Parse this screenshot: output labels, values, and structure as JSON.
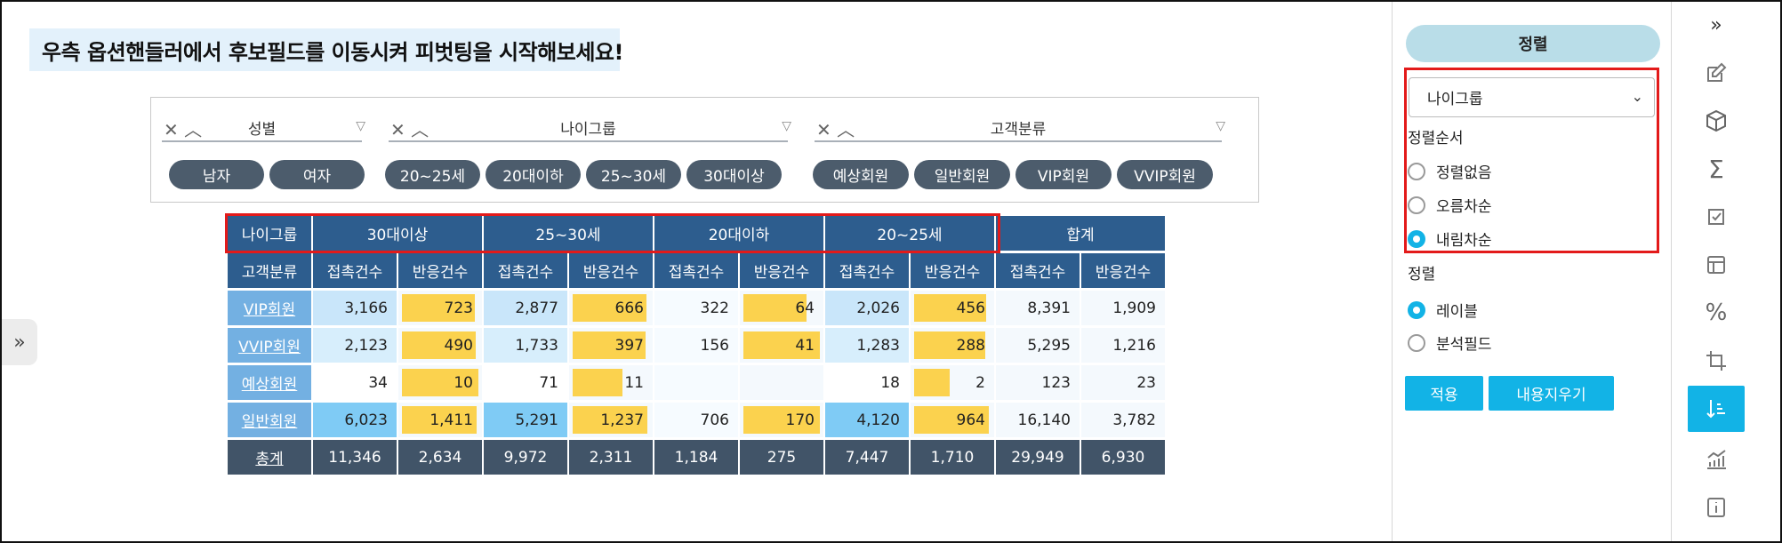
{
  "banner": {
    "text": "우측 옵션핸들러에서 후보필드를 이동시켜 피벗팅을 시작해보세요!"
  },
  "filters": [
    {
      "title": "성별",
      "controls": "✕ ︿",
      "filter_icon": "▽",
      "chips": [
        "남자",
        "여자"
      ]
    },
    {
      "title": "나이그룹",
      "controls": "✕ ︿",
      "filter_icon": "▽",
      "chips": [
        "20~25세",
        "20대이하",
        "25~30세",
        "30대이상"
      ]
    },
    {
      "title": "고객분류",
      "controls": "✕ ︿",
      "filter_icon": "▽",
      "chips": [
        "예상회원",
        "일반회원",
        "VIP회원",
        "VVIP회원"
      ]
    }
  ],
  "pivot": {
    "col_group_label": "나이그룹",
    "row_group_label": "고객분류",
    "groups": [
      "30대이상",
      "25~30세",
      "20대이하",
      "20~25세",
      "합계"
    ],
    "measures": [
      "접촉건수",
      "반응건수"
    ],
    "rows": [
      {
        "label": "VIP회원",
        "values": [
          "3,166",
          "723",
          "2,877",
          "666",
          "322",
          "64",
          "2,026",
          "456",
          "8,391",
          "1,909"
        ]
      },
      {
        "label": "VVIP회원",
        "values": [
          "2,123",
          "490",
          "1,733",
          "397",
          "156",
          "41",
          "1,283",
          "288",
          "5,295",
          "1,216"
        ]
      },
      {
        "label": "예상회원",
        "values": [
          "34",
          "10",
          "71",
          "11",
          "",
          "",
          "18",
          "2",
          "123",
          "23"
        ]
      },
      {
        "label": "일반회원",
        "values": [
          "6,023",
          "1,411",
          "5,291",
          "1,237",
          "706",
          "170",
          "4,120",
          "964",
          "16,140",
          "3,782"
        ]
      }
    ],
    "total": {
      "label": "총계",
      "values": [
        "11,346",
        "2,634",
        "9,972",
        "2,311",
        "1,184",
        "275",
        "7,447",
        "1,710",
        "29,949",
        "6,930"
      ]
    },
    "colors": {
      "header": "#2d5d8e",
      "row_label": "#73b0e2",
      "total": "#415468",
      "bar": "#fbd24e",
      "highlight": "#e31a1a"
    }
  },
  "panel": {
    "title": "정렬",
    "select_value": "나이그룹",
    "order_label": "정렬순서",
    "order_options": [
      "정렬없음",
      "오름차순",
      "내림차순"
    ],
    "order_selected": 2,
    "sort_label": "정렬",
    "sort_options": [
      "레이블",
      "분석필드"
    ],
    "sort_selected": 0,
    "apply_label": "적용",
    "clear_label": "내용지우기",
    "accent": "#12b3e6"
  },
  "iconbar": {
    "icons": [
      "collapse-icon",
      "edit-icon",
      "cube-icon",
      "sigma-icon",
      "checklist-icon",
      "layout-icon",
      "percent-icon",
      "crop-icon",
      "sort-icon",
      "chart-icon",
      "info-icon"
    ],
    "active": "sort-icon"
  },
  "expand_glyph": "»",
  "collapse_glyph": "»"
}
